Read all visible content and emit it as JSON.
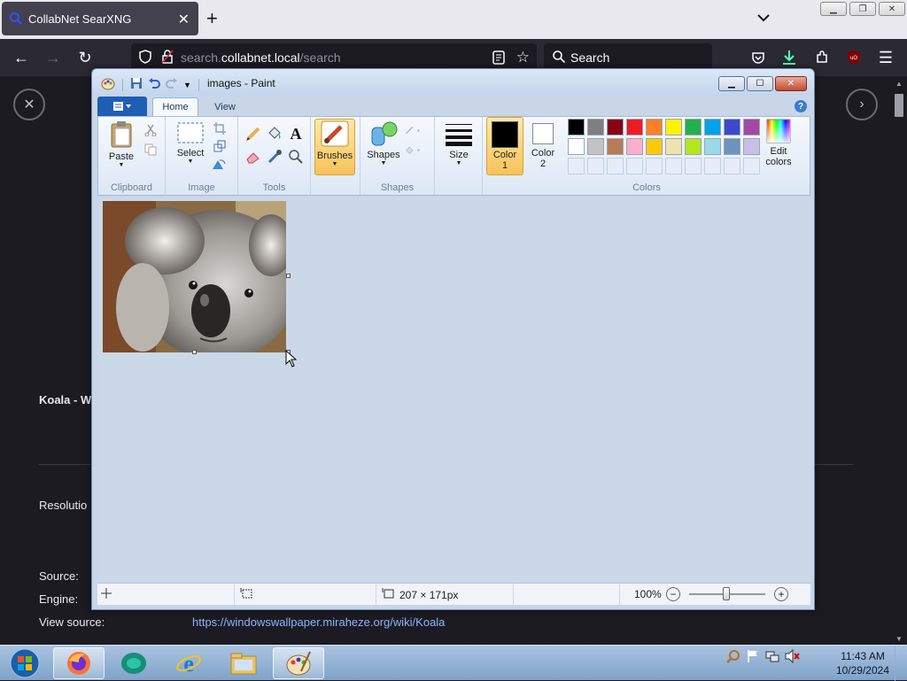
{
  "browser": {
    "tab_title": "CollabNet SearXNG",
    "url_prefix": "search.",
    "url_host": "collabnet.local",
    "url_path": "/search",
    "search_placeholder": "Search"
  },
  "page": {
    "result_title": "Koala - W",
    "resolution_label": "Resolutio",
    "source_label": "Source:",
    "engine_label": "Engine:",
    "view_source_label": "View source:",
    "view_source_url": "https://windowswallpaper.miraheze.org/wiki/Koala"
  },
  "paint": {
    "title": "images - Paint",
    "tabs": [
      "Home",
      "View"
    ],
    "groups": {
      "clipboard": "Clipboard",
      "image": "Image",
      "tools": "Tools",
      "shapes": "Shapes",
      "colors": "Colors"
    },
    "buttons": {
      "paste": "Paste",
      "select": "Select",
      "brushes": "Brushes",
      "shapes": "Shapes",
      "size": "Size",
      "color1_line1": "Color",
      "color1_line2": "1",
      "color2_line1": "Color",
      "color2_line2": "2",
      "edit_colors_line1": "Edit",
      "edit_colors_line2": "colors"
    },
    "palette_row1": [
      "#000000",
      "#7f7f7f",
      "#880015",
      "#ed1c24",
      "#ff7f27",
      "#fff200",
      "#22b14c",
      "#00a2e8",
      "#3f48cc",
      "#a349a4"
    ],
    "palette_row2": [
      "#ffffff",
      "#c3c3c3",
      "#b97a57",
      "#ffaec9",
      "#ffc90e",
      "#efe4b0",
      "#b5e61d",
      "#99d9ea",
      "#7092be",
      "#c8bfe7"
    ],
    "color1": "#000000",
    "color2": "#ffffff",
    "status": {
      "image_size": "207 × 171px",
      "zoom": "100%"
    }
  },
  "taskbar": {
    "time": "11:43 AM",
    "date": "10/29/2024"
  }
}
